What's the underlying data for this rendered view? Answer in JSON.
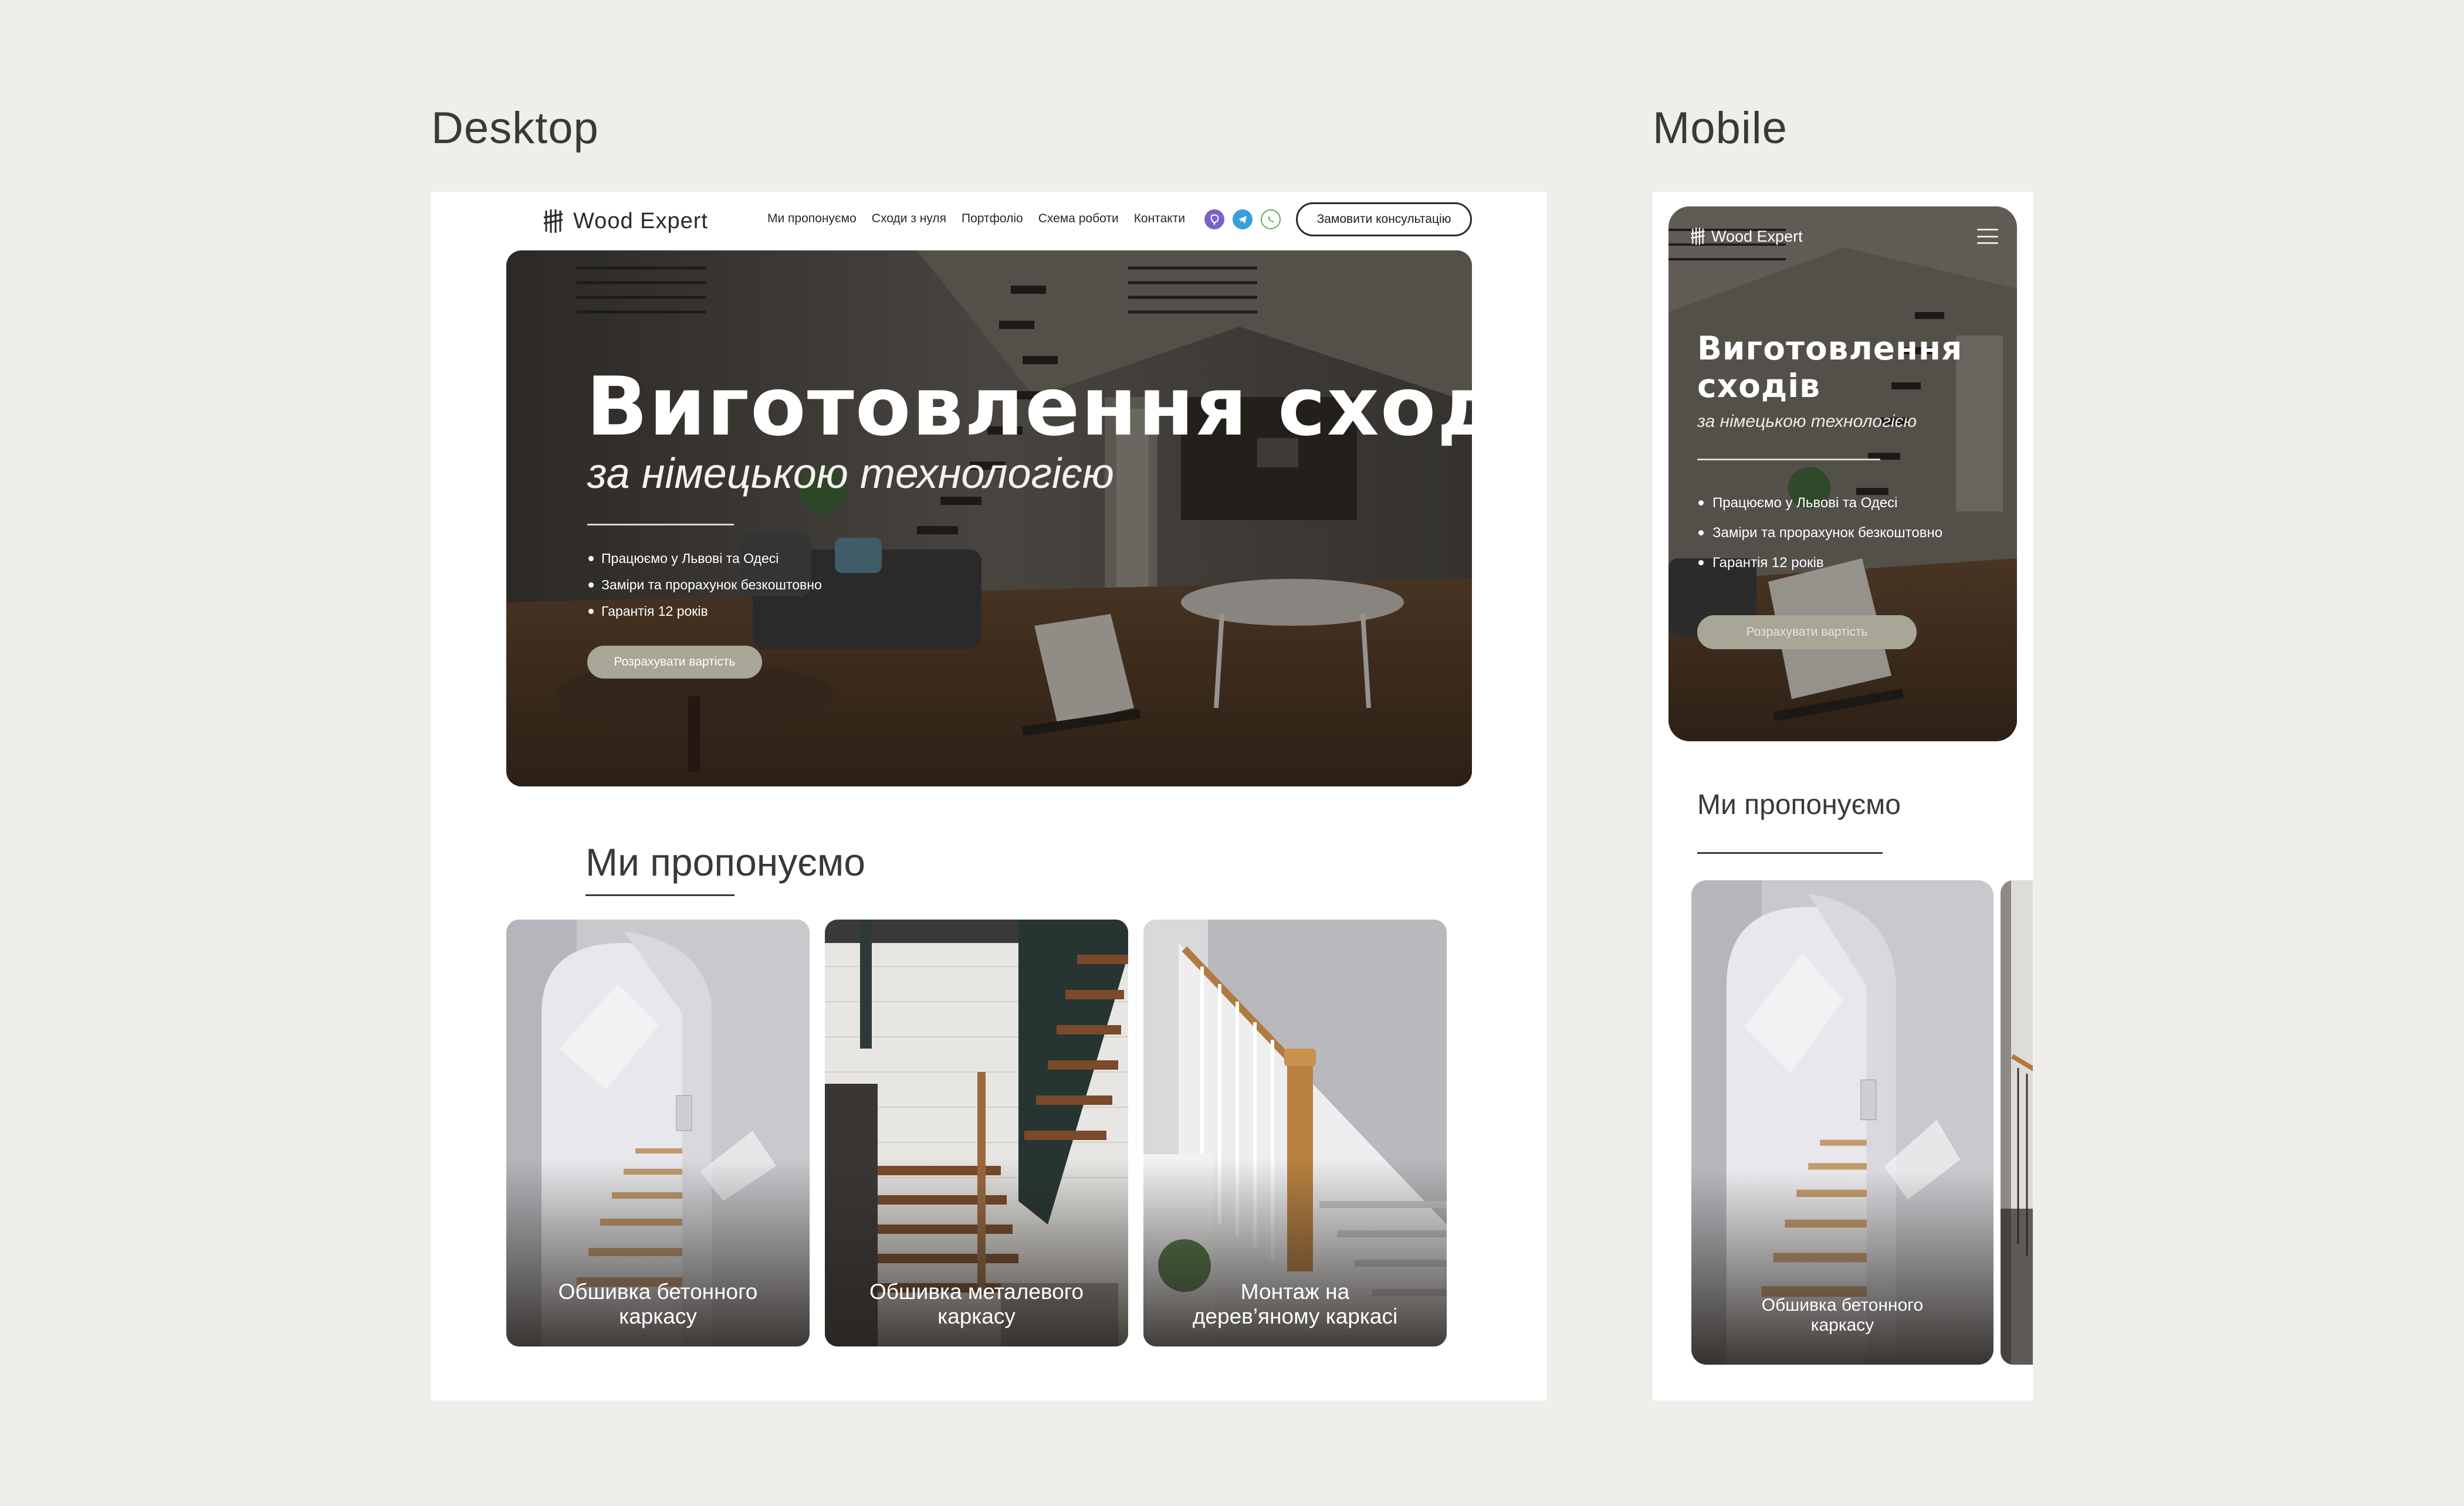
{
  "labels": {
    "desktop": "Desktop",
    "mobile": "Mobile"
  },
  "brand": {
    "name": "Wood Expert"
  },
  "nav": {
    "items": [
      "Ми пропонуємо",
      "Сходи з нуля",
      "Портфоліо",
      "Схема роботи",
      "Контакти"
    ],
    "social": [
      "viber-icon",
      "telegram-icon",
      "whatsapp-icon"
    ],
    "cta": "Замовити консультацію"
  },
  "hero": {
    "title": "Виготовлення сходів",
    "title_mobile_1": "Виготовлення",
    "title_mobile_2": "сходів",
    "subtitle": "за німецькою технологією",
    "bullets": [
      "Працюємо у Львові та Одесі",
      "Заміри та прорахунок безкоштовно",
      "Гарантія 12 років"
    ],
    "button": "Розрахувати вартість"
  },
  "offers": {
    "title": "Ми пропонуємо",
    "cards": [
      {
        "line1": "Обшивка бетонного",
        "line2": "каркасу"
      },
      {
        "line1": "Обшивка металевого",
        "line2": "каркасу"
      },
      {
        "line1": "Монтаж на",
        "line2": "дерев’яному каркасі"
      }
    ]
  },
  "colors": {
    "page_bg": "#efeeea",
    "button_bg": "#a8a697",
    "text_dark": "#2b2926"
  }
}
